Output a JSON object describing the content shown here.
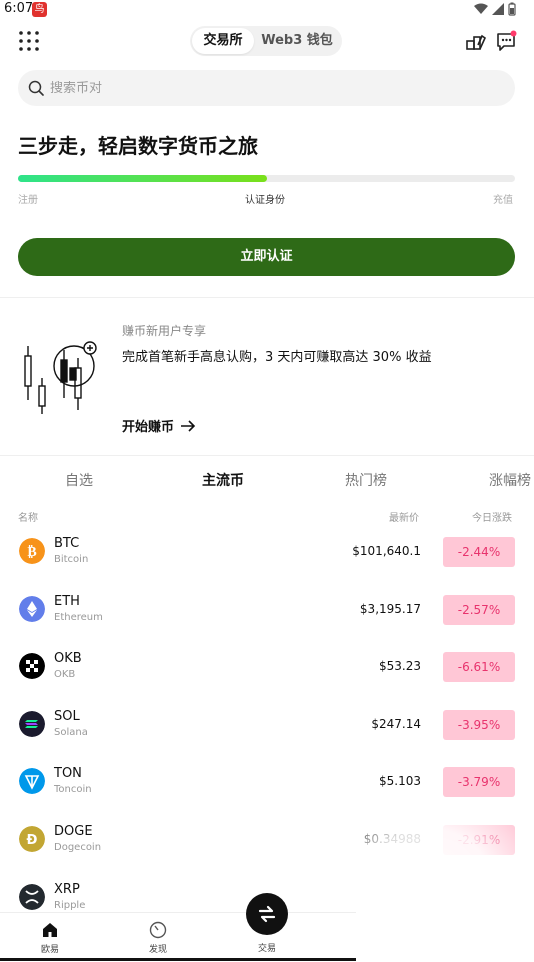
{
  "status": {
    "time": "6:07",
    "badge": "鸟"
  },
  "header": {
    "tabs": [
      "交易所",
      "Web3 钱包"
    ],
    "active_tab": 0
  },
  "search": {
    "placeholder": "搜索币对"
  },
  "onboarding": {
    "title": "三步走，轻启数字货币之旅",
    "progress": 0.5,
    "steps": [
      "注册",
      "认证身份",
      "充值"
    ],
    "current_step": 1,
    "cta": "立即认证"
  },
  "promo": {
    "subtitle": "赚币新用户专享",
    "title": "完成首笔新手高息认购，3 天内可赚取高达 30% 收益",
    "link": "开始赚币"
  },
  "market": {
    "tabs": [
      "自选",
      "主流币",
      "热门榜",
      "涨幅榜"
    ],
    "active_tab": 1,
    "columns": {
      "name": "名称",
      "price": "最新价",
      "change": "今日涨跌"
    },
    "rows": [
      {
        "symbol": "BTC",
        "name": "Bitcoin",
        "price": "$101,640.1",
        "change": "-2.44%",
        "color": "#f7931a"
      },
      {
        "symbol": "ETH",
        "name": "Ethereum",
        "price": "$3,195.17",
        "change": "-2.57%",
        "color": "#627eea"
      },
      {
        "symbol": "OKB",
        "name": "OKB",
        "price": "$53.23",
        "change": "-6.61%",
        "color": "#000000"
      },
      {
        "symbol": "SOL",
        "name": "Solana",
        "price": "$247.14",
        "change": "-3.95%",
        "color": "#1b1b2e"
      },
      {
        "symbol": "TON",
        "name": "Toncoin",
        "price": "$5.103",
        "change": "-3.79%",
        "color": "#0098ea"
      },
      {
        "symbol": "DOGE",
        "name": "Dogecoin",
        "price": "$0.34988",
        "change": "-2.91%",
        "color": "#c2a633"
      },
      {
        "symbol": "XRP",
        "name": "Ripple",
        "price": "",
        "change": "",
        "color": "#23292f"
      }
    ]
  },
  "bottom_nav": {
    "items": [
      "欧易",
      "发现",
      "交易"
    ]
  },
  "colors": {
    "brand_green": "#2e6a17",
    "down_bg": "#ffc7d6",
    "down_text": "#e8336d"
  }
}
